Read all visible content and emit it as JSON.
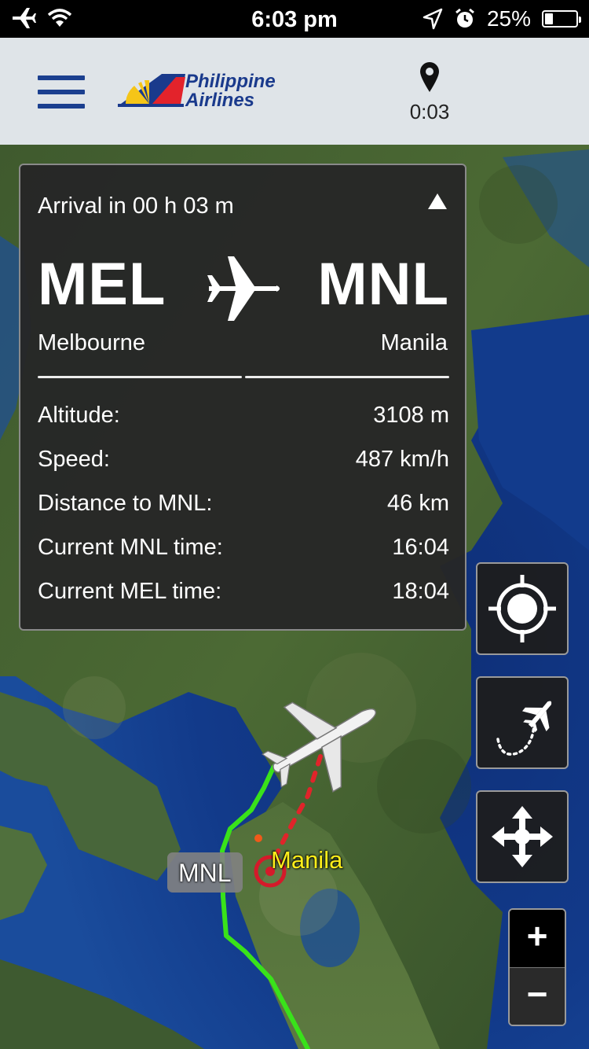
{
  "status_bar": {
    "time": "6:03 pm",
    "battery_percent": "25%",
    "battery_level": 0.25,
    "icons": [
      "airplane-mode-icon",
      "wifi-icon",
      "location-arrow-icon",
      "alarm-icon",
      "battery-icon"
    ]
  },
  "header": {
    "brand_line1": "Philippine",
    "brand_line2": "Airlines",
    "timer": "0:03",
    "menu_icon": "hamburger-menu-icon",
    "timer_icon": "map-pin-icon",
    "colors": {
      "brand_blue": "#1a3a8c",
      "header_bg": "#dfe4e8"
    }
  },
  "flight": {
    "arrival": "Arrival in 00 h 03 m",
    "origin_code": "MEL",
    "destination_code": "MNL",
    "origin_city": "Melbourne",
    "destination_city": "Manila",
    "stats": [
      {
        "label": "Altitude:",
        "value": "3108 m"
      },
      {
        "label": "Speed:",
        "value": "487 km/h"
      },
      {
        "label": "Distance to MNL:",
        "value": "46 km"
      },
      {
        "label": "Current MNL time:",
        "value": "16:04"
      },
      {
        "label": "Current MEL time:",
        "value": "18:04"
      }
    ]
  },
  "map": {
    "airport_badge": "MNL",
    "city_label": "Manila",
    "colors": {
      "flown_path": "#39e21a",
      "planned_path": "#e0242a",
      "city_label": "#ffef1a"
    }
  },
  "controls": {
    "icons": [
      "center-location-icon",
      "flight-path-icon",
      "pan-arrows-icon"
    ],
    "zoom_in": "+",
    "zoom_out": "−"
  }
}
